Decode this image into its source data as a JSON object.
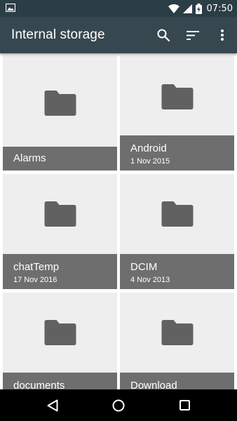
{
  "status_bar": {
    "time": "07:50",
    "icons": [
      "image-notification-icon",
      "wifi-icon",
      "signal-icon",
      "battery-charging-icon"
    ]
  },
  "app_bar": {
    "title": "Internal storage",
    "actions": [
      "search-icon",
      "sort-icon",
      "more-vert-icon"
    ]
  },
  "folders": [
    {
      "name": "Alarms",
      "date": ""
    },
    {
      "name": "Android",
      "date": "1 Nov 2015"
    },
    {
      "name": "chatTemp",
      "date": "17 Nov 2016"
    },
    {
      "name": "DCIM",
      "date": "4 Nov 2013"
    },
    {
      "name": "documents",
      "date": ""
    },
    {
      "name": "Download",
      "date": ""
    }
  ],
  "nav_bar": {
    "buttons": [
      "back-icon",
      "home-icon",
      "recents-icon"
    ]
  },
  "colors": {
    "status_bar": "#2b3e45",
    "app_bar": "#37474f",
    "tile_bg": "#eeeeee",
    "caption_bg": "#6e6e6e",
    "folder_icon": "#616161"
  }
}
